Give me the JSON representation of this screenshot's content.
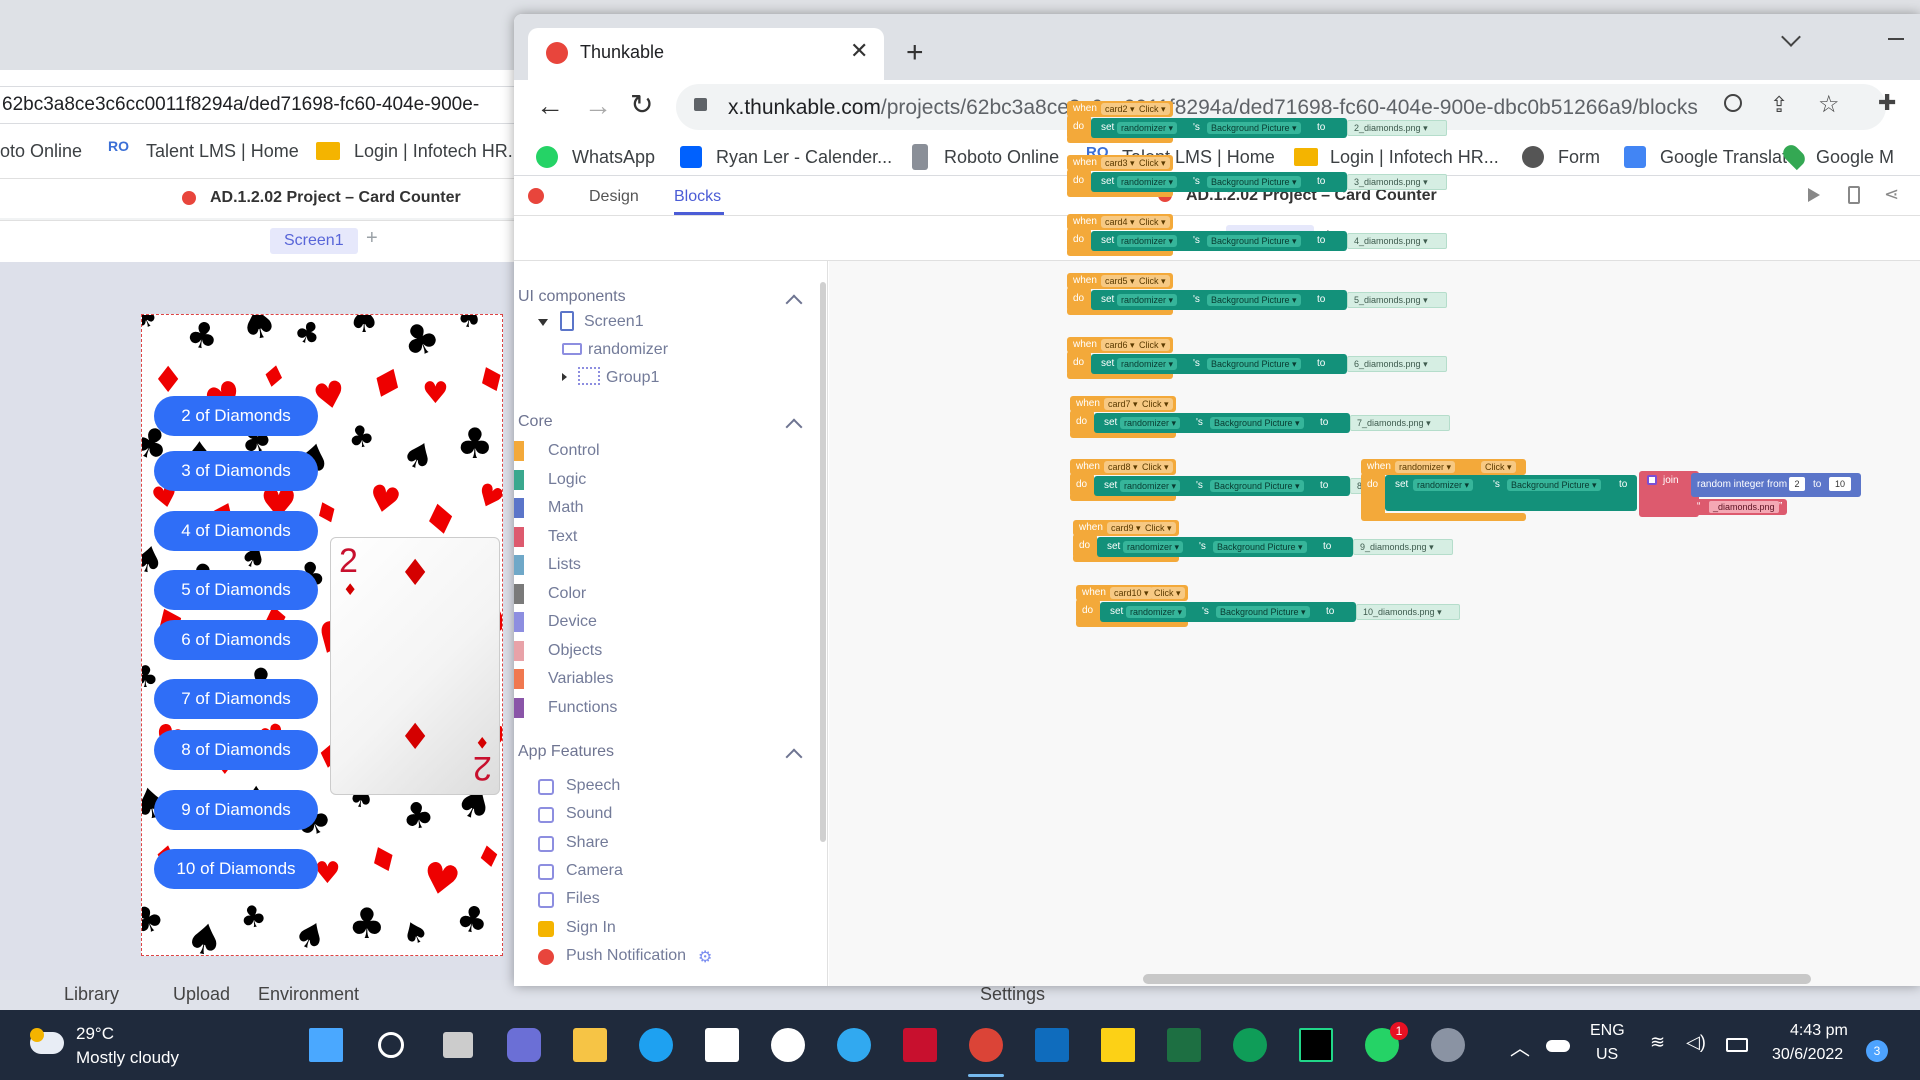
{
  "bg_window": {
    "url_fragment": "62bc3a8ce3c6cc0011f8294a/ded71698-fc60-404e-900e-",
    "bookmarks": [
      "oto Online",
      "Talent LMS | Home",
      "Login | Infotech HR..."
    ],
    "project_title": "AD.1.2.02 Project – Card Counter",
    "screen_tab": "Screen1",
    "buttons": [
      "2 of Diamonds",
      "3 of Diamonds",
      "4 of Diamonds",
      "5 of Diamonds",
      "6 of Diamonds",
      "7 of Diamonds",
      "8 of Diamonds",
      "9 of Diamonds",
      "10 of Diamonds"
    ],
    "card_rank": "2",
    "bottom_tabs": [
      "Library",
      "Upload",
      "Environment",
      "Settings"
    ]
  },
  "browser": {
    "tab_title": "Thunkable",
    "url_host": "x.thunkable.com",
    "url_path": "/projects/62bc3a8ce3c6cc0011f8294a/ded71698-fc60-404e-900e-dbc0b51266a9/blocks",
    "bookmarks": [
      "WhatsApp",
      "Ryan Ler - Calender...",
      "Roboto Online",
      "Talent LMS | Home",
      "Login | Infotech HR...",
      "Form",
      "Google Translate",
      "Google M"
    ]
  },
  "app": {
    "tabs": [
      "Design",
      "Blocks"
    ],
    "active_tab": "Blocks",
    "project_title": "AD.1.2.02 Project – Card Counter",
    "screen_tab": "Screen1"
  },
  "panel": {
    "ui_components": "UI components",
    "tree": [
      "Screen1",
      "randomizer",
      "Group1"
    ],
    "core": "Core",
    "core_items": [
      {
        "label": "Control",
        "color": "#f3a93a"
      },
      {
        "label": "Logic",
        "color": "#3aa88e"
      },
      {
        "label": "Math",
        "color": "#5b75c9"
      },
      {
        "label": "Text",
        "color": "#dd5a6e"
      },
      {
        "label": "Lists",
        "color": "#6fa8c8"
      },
      {
        "label": "Color",
        "color": "#7a7a7a"
      },
      {
        "label": "Device",
        "color": "#8d8ee0"
      },
      {
        "label": "Objects",
        "color": "#e8a2a8"
      },
      {
        "label": "Variables",
        "color": "#f07850"
      },
      {
        "label": "Functions",
        "color": "#8a55a8"
      }
    ],
    "app_features": "App Features",
    "feature_items": [
      "Speech",
      "Sound",
      "Share",
      "Camera",
      "Files",
      "Sign In",
      "Push Notification"
    ]
  },
  "blocks": {
    "when": "when",
    "do": "do",
    "set": "set",
    "to": "to",
    "s": "'s",
    "event": "Click",
    "component": "randomizer",
    "property": "Background Picture",
    "handlers": [
      {
        "card": "card2",
        "file": "2_diamonds.png"
      },
      {
        "card": "card3",
        "file": "3_diamonds.png"
      },
      {
        "card": "card4",
        "file": "4_diamonds.png"
      },
      {
        "card": "card5",
        "file": "5_diamonds.png"
      },
      {
        "card": "card6",
        "file": "6_diamonds.png"
      },
      {
        "card": "card7",
        "file": "7_diamonds.png"
      },
      {
        "card": "card8",
        "file": "8_diamonds.png"
      },
      {
        "card": "card9",
        "file": "9_diamonds.png"
      },
      {
        "card": "card10",
        "file": "10_diamonds.png"
      }
    ],
    "random": {
      "join": "join",
      "random_label": "random integer from",
      "from": "2",
      "to_val": "10",
      "suffix": "_diamonds.png"
    }
  },
  "taskbar": {
    "temp": "29°C",
    "weather": "Mostly cloudy",
    "lang1": "ENG",
    "lang2": "US",
    "time": "4:43 pm",
    "date": "30/6/2022",
    "notif_count": "3",
    "whatsapp_badge": "1"
  }
}
